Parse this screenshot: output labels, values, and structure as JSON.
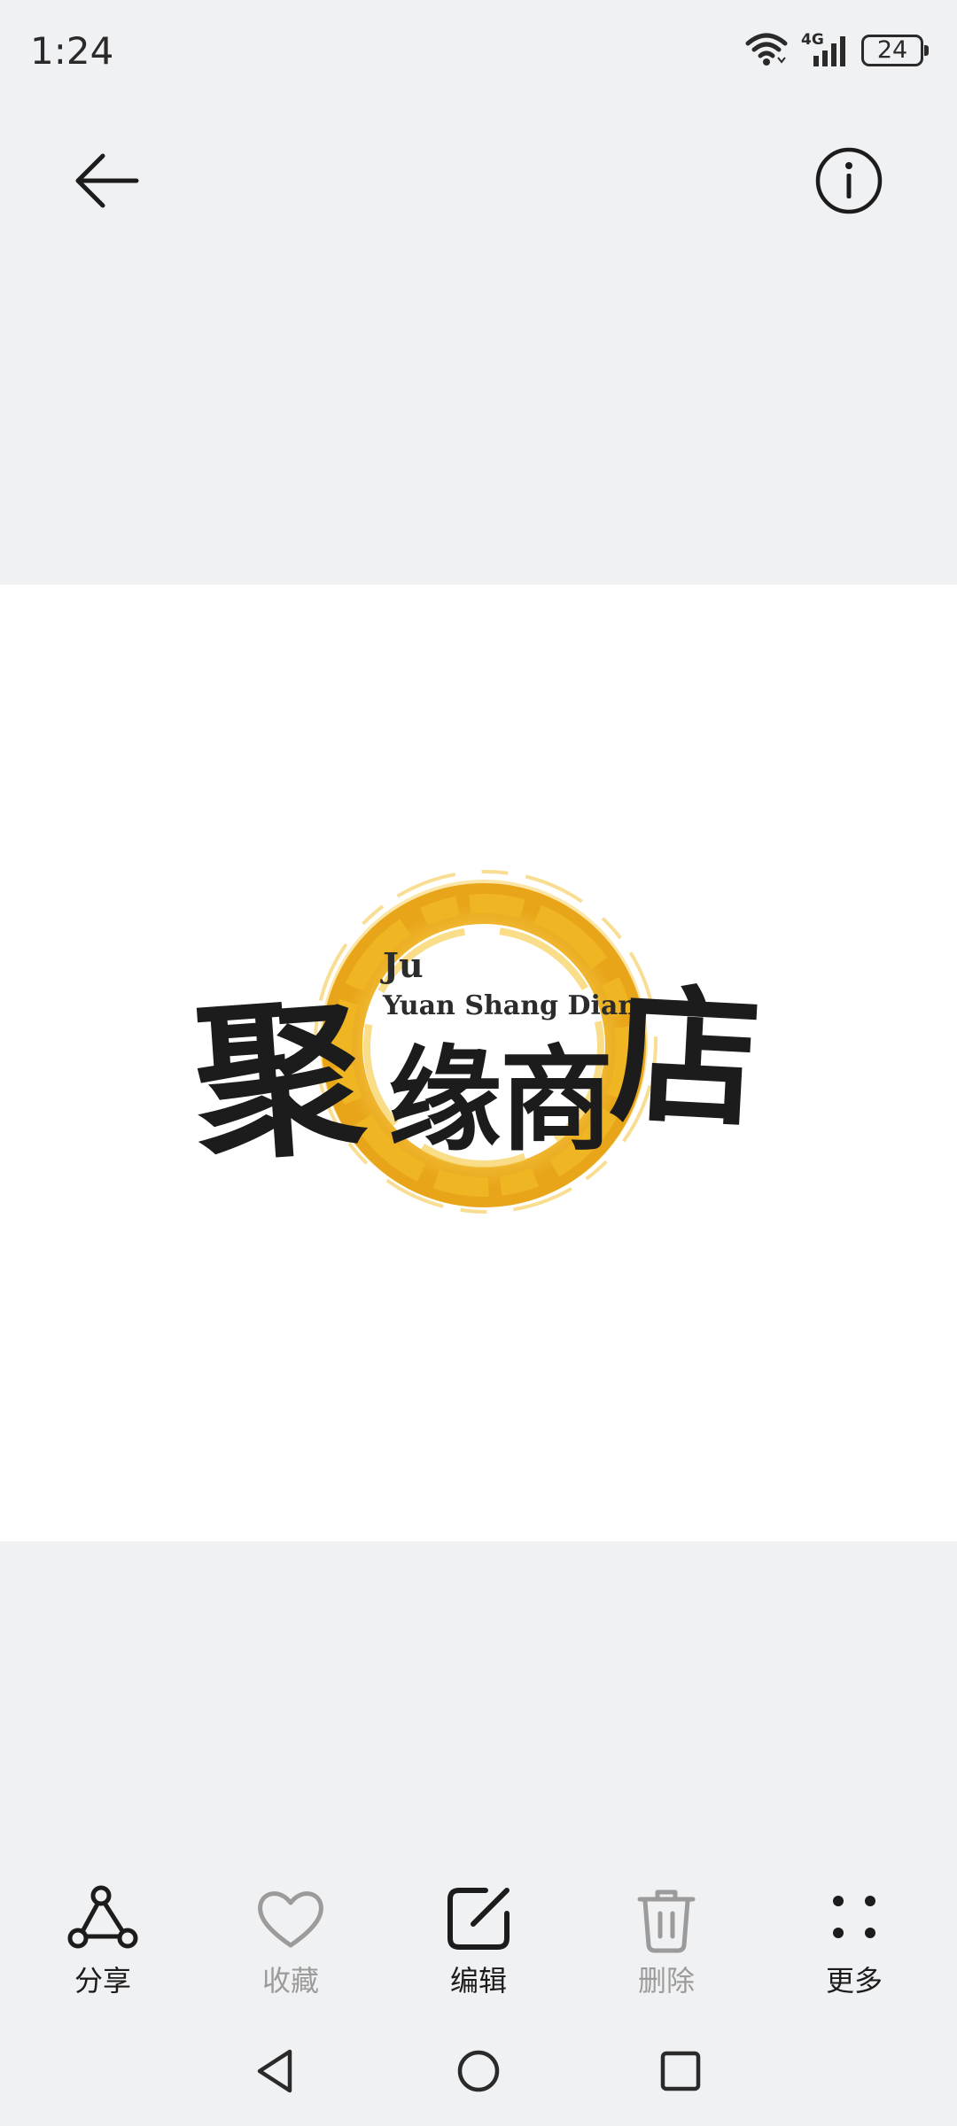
{
  "status_bar": {
    "time": "1:24",
    "network": "4G",
    "battery_level": "24",
    "icons": [
      "wifi-icon",
      "cellular-signal-icon",
      "battery-icon"
    ]
  },
  "top_bar": {
    "back_icon": "arrow-left-icon",
    "info_icon": "info-circle-icon"
  },
  "image": {
    "logo_text_en_line1": "Ju",
    "logo_text_en_line2": "Yuan Shang Dian",
    "logo_text_cn": [
      "聚",
      "缘",
      "商",
      "店"
    ],
    "ring_color": "#f0b523",
    "background": "#ffffff"
  },
  "actions": [
    {
      "label": "分享",
      "icon": "share-icon",
      "enabled": true
    },
    {
      "label": "收藏",
      "icon": "heart-icon",
      "enabled": false
    },
    {
      "label": "编辑",
      "icon": "edit-icon",
      "enabled": true
    },
    {
      "label": "删除",
      "icon": "trash-icon",
      "enabled": false
    },
    {
      "label": "更多",
      "icon": "more-icon",
      "enabled": true
    }
  ],
  "nav_bar": {
    "icons": [
      "nav-back-icon",
      "nav-home-icon",
      "nav-recents-icon"
    ]
  },
  "colors": {
    "page_background": "#f0f1f3",
    "icon_active": "#1c1c1c",
    "icon_disabled": "#9b9b9b"
  }
}
